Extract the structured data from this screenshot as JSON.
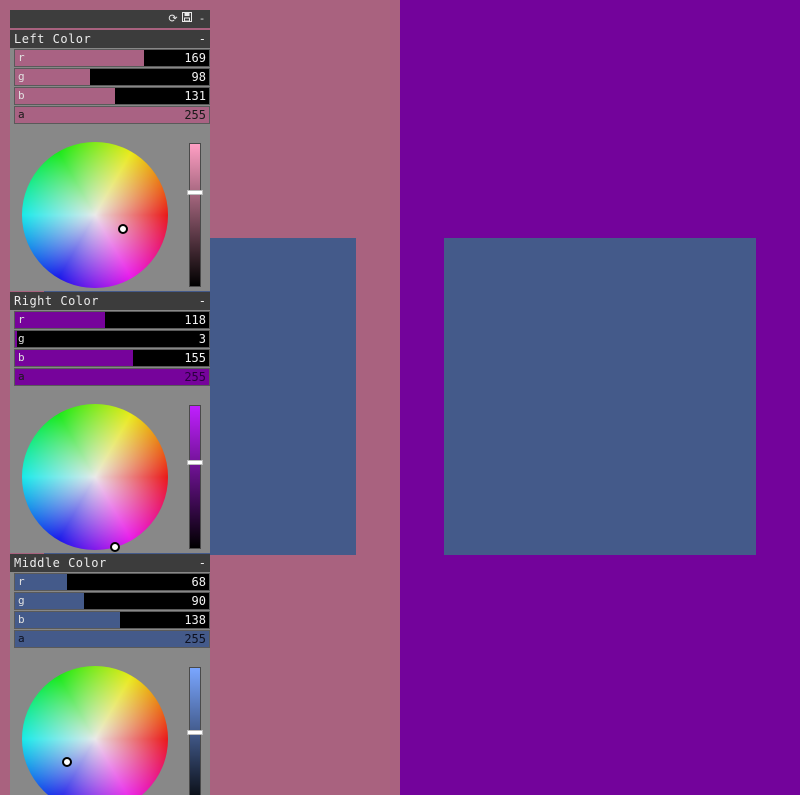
{
  "colors": {
    "left_background": "#a9627f",
    "right_background": "#73039b",
    "middle_square": "#445a8a"
  },
  "titlebar": {
    "refresh_icon": "refresh-icon",
    "save_icon": "save-icon",
    "collapse_label": "-"
  },
  "sections": [
    {
      "title": "Left Color",
      "collapse": "-",
      "color": "#a96283",
      "r": {
        "label": "r",
        "value": "169"
      },
      "g": {
        "label": "g",
        "value": "98"
      },
      "b": {
        "label": "b",
        "value": "131"
      },
      "a": {
        "label": "a",
        "value": "255"
      }
    },
    {
      "title": "Right Color",
      "collapse": "-",
      "color": "#76039b",
      "r": {
        "label": "r",
        "value": "118"
      },
      "g": {
        "label": "g",
        "value": "3"
      },
      "b": {
        "label": "b",
        "value": "155"
      },
      "a": {
        "label": "a",
        "value": "255"
      }
    },
    {
      "title": "Middle Color",
      "collapse": "-",
      "color": "#445a8a",
      "r": {
        "label": "r",
        "value": "68"
      },
      "g": {
        "label": "g",
        "value": "90"
      },
      "b": {
        "label": "b",
        "value": "138"
      },
      "a": {
        "label": "a",
        "value": "255"
      }
    }
  ]
}
